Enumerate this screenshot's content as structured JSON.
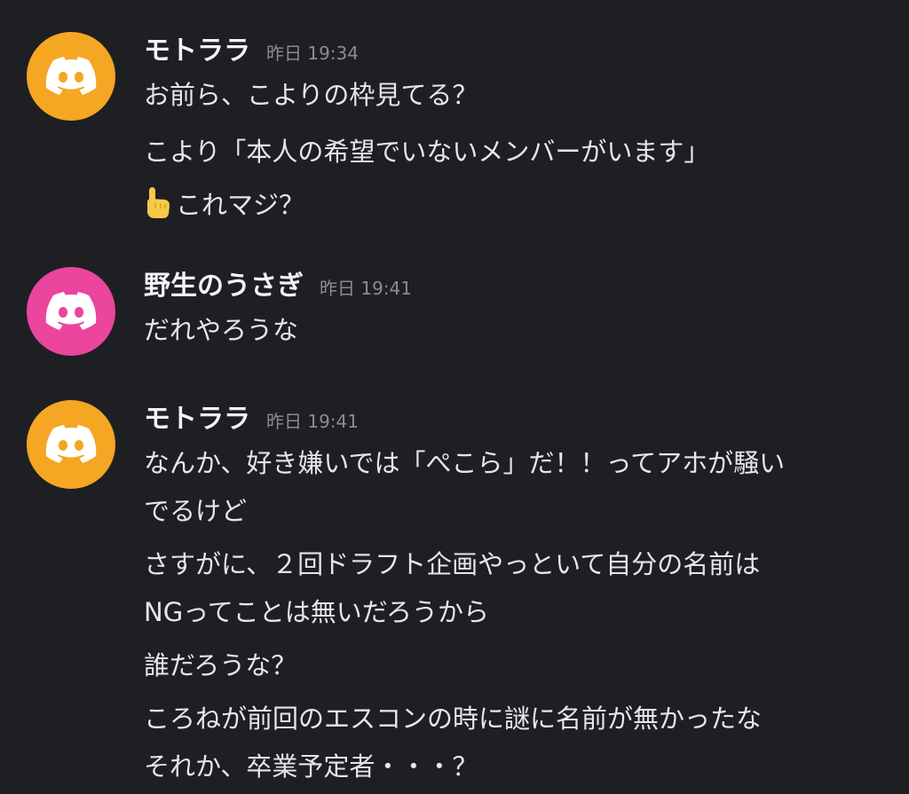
{
  "colors": {
    "background": "#1e1f23",
    "avatar_orange": "#f5a623",
    "avatar_pink": "#eb459e"
  },
  "messages": [
    {
      "username": "モトララ",
      "timestamp": "昨日 19:34",
      "avatar_icon": "discord-logo-icon",
      "lines": [
        "お前ら、こよりの枠見てる？",
        "こより「本人の希望でいないメンバーがいます」",
        "これマジ？"
      ],
      "line3_icon": "pointing-up-emoji-icon"
    },
    {
      "username": "野生のうさぎ",
      "timestamp": "昨日 19:41",
      "avatar_icon": "discord-logo-icon",
      "lines": [
        "だれやろうな"
      ]
    },
    {
      "username": "モトララ",
      "timestamp": "昨日 19:41",
      "avatar_icon": "discord-logo-icon",
      "lines": [
        "なんか、好き嫌いでは「ぺこら」だ！！ってアホが騒い",
        "でるけど",
        "さすがに、２回ドラフト企画やっといて自分の名前は",
        "NGってことは無いだろうから",
        "誰だろうな？",
        "ころねが前回のエスコンの時に謎に名前が無かったな",
        "それか、卒業予定者・・・？"
      ]
    }
  ]
}
